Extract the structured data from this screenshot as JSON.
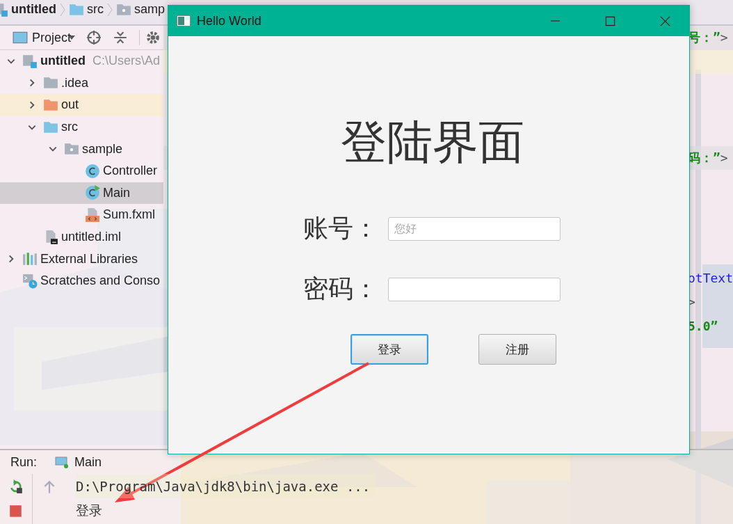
{
  "ide": {
    "breadcrumbs": [
      {
        "label": "untitled",
        "kind": "module"
      },
      {
        "label": "src",
        "kind": "source-folder"
      },
      {
        "label": "samp",
        "kind": "package"
      }
    ],
    "project_toolbar": {
      "title": "Project"
    },
    "tree": [
      {
        "label": "untitled",
        "path": "C:\\Users\\Ad",
        "kind": "module",
        "expanded": true,
        "selected": false,
        "children": [
          {
            "label": ".idea",
            "kind": "folder",
            "expanded": false,
            "selected": false
          },
          {
            "label": "out",
            "kind": "excluded-folder",
            "expanded": false,
            "selected": false
          },
          {
            "label": "src",
            "kind": "source-folder",
            "expanded": true,
            "selected": false,
            "children": [
              {
                "label": "sample",
                "kind": "package",
                "expanded": true,
                "selected": false,
                "children": [
                  {
                    "label": "Controller",
                    "kind": "class",
                    "selected": false
                  },
                  {
                    "label": "Main",
                    "kind": "main-class",
                    "selected": true
                  },
                  {
                    "label": "Sum.fxml",
                    "kind": "fxml",
                    "selected": false
                  }
                ]
              }
            ]
          },
          {
            "label": "untitled.iml",
            "kind": "iml",
            "selected": false
          }
        ]
      },
      {
        "label": "External Libraries",
        "kind": "libraries",
        "expanded": false,
        "selected": false
      },
      {
        "label": "Scratches and Conso",
        "kind": "scratches",
        "selected": false
      }
    ],
    "code_lines": [
      {
        "parts": [
          {
            "text": "号：”",
            "kind": "string"
          },
          {
            "text": ">",
            "kind": "tag"
          }
        ]
      },
      {
        "parts": [
          {
            "text": "码：”",
            "kind": "string"
          },
          {
            "text": ">",
            "kind": "tag"
          }
        ]
      },
      {
        "parts": [
          {
            "text": "otText",
            "kind": "attribute"
          }
        ]
      },
      {
        "parts": [
          {
            "text": ">",
            "kind": "tag"
          }
        ]
      },
      {
        "parts": [
          {
            "text": "5.0”",
            "kind": "string"
          }
        ]
      }
    ],
    "run": {
      "label": "Run:",
      "tab": "Main",
      "console": [
        "D:\\Program\\Java\\jdk8\\bin\\java.exe ...",
        "登录"
      ]
    }
  },
  "dialog": {
    "title": "Hello World",
    "heading": "登陆界面",
    "fields": [
      {
        "label": "账号：",
        "placeholder": "您好"
      },
      {
        "label": "密码："
      }
    ],
    "buttons": [
      {
        "label": "登录",
        "focused": true
      },
      {
        "label": "注册",
        "focused": false
      }
    ]
  }
}
